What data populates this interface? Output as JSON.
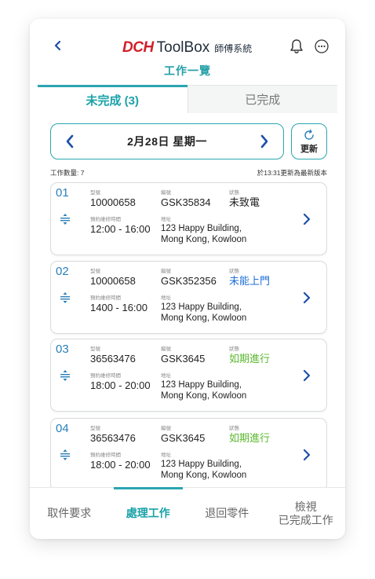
{
  "header": {
    "brand_dch": "DCH",
    "brand_toolbox": "ToolBox",
    "brand_sub": "師傅系統",
    "title": "工作一覽",
    "back_icon": "chevron-left-icon",
    "notification_icon": "bell-icon",
    "more_icon": "ellipsis-icon"
  },
  "tabs": [
    {
      "label": "未完成 (3)",
      "active": true
    },
    {
      "label": "已完成",
      "active": false
    }
  ],
  "date_bar": {
    "date": "2月28日 星期一",
    "refresh_label": "更新"
  },
  "meta": {
    "job_count": "工作數量: 7",
    "updated": "於13:31更新為最新版本"
  },
  "labels": {
    "model": "型號",
    "code": "編號",
    "status": "狀態",
    "time": "預約維修時間",
    "address": "地址"
  },
  "jobs": [
    {
      "index": "01",
      "model": "10000658",
      "code": "GSK35834",
      "status": "未致電",
      "time": "12:00 - 16:00",
      "address_1": "123 Happy Building,",
      "address_2": "Mong Kong, Kowloon"
    },
    {
      "index": "02",
      "model": "10000658",
      "code": "GSK352356",
      "status": "未能上門",
      "time": "1400 - 16:00",
      "address_1": "123 Happy Building,",
      "address_2": "Mong Kong, Kowloon"
    },
    {
      "index": "03",
      "model": "36563476",
      "code": "GSK3645",
      "status": "如期進行",
      "time": "18:00 - 20:00",
      "address_1": "123 Happy Building,",
      "address_2": "Mong Kong, Kowloon"
    },
    {
      "index": "04",
      "model": "36563476",
      "code": "GSK3645",
      "status": "如期進行",
      "time": "18:00 - 20:00",
      "address_1": "123 Happy Building,",
      "address_2": "Mong Kong, Kowloon"
    }
  ],
  "bottom_nav": [
    {
      "label": "取件要求",
      "active": false
    },
    {
      "label": "處理工作",
      "active": true
    },
    {
      "label": "退回零件",
      "active": false
    },
    {
      "label_1": "檢視",
      "label_2": "已完成工作",
      "active": false
    }
  ],
  "colors": {
    "accent": "#2aa5b0",
    "brand_red": "#d21f2b",
    "status_blue": "#1f6fd6",
    "status_green": "#5ab82e"
  }
}
